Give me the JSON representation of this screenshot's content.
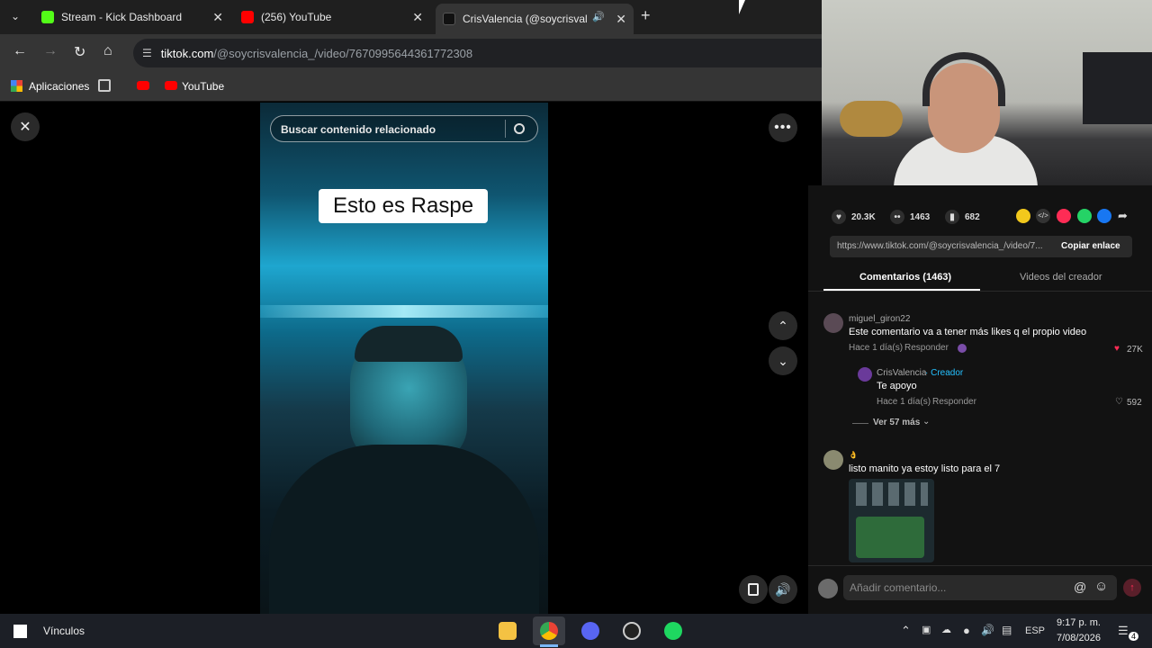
{
  "browser": {
    "tabs": [
      {
        "title": "Stream - Kick Dashboard"
      },
      {
        "title": "(256) YouTube"
      },
      {
        "title": "CrisValencia (@soycrisvalen"
      }
    ],
    "new_tab": "+",
    "url_host": "tiktok.com",
    "url_path": "/@soycrisvalencia_/video/7670995644361772308",
    "bookmarks": [
      {
        "label": "Aplicaciones"
      },
      {
        "label": "YouTube"
      }
    ]
  },
  "video": {
    "search_placeholder": "Buscar contenido relacionado",
    "caption": "Esto es Raspe"
  },
  "stats": {
    "likes": "20.3K",
    "comments": "1463",
    "saves": "682"
  },
  "link": {
    "url": "https://www.tiktok.com/@soycrisvalencia_/video/7...",
    "copy_label": "Copiar enlace"
  },
  "comment_tabs": [
    {
      "label": "Comentarios (1463)"
    },
    {
      "label": "Videos del creador"
    }
  ],
  "comments": [
    {
      "user": "miguel_giron22",
      "text": "Este comentario va a tener más likes q el propio video",
      "time": "Hace 1 día(s)",
      "reply": "Responder",
      "likes": "27K",
      "replies": [
        {
          "user": "CrisValencia",
          "creator_tag": " · Creador",
          "text": "Te apoyo",
          "time": "Hace 1 día(s)",
          "reply": "Responder",
          "likes": "592"
        }
      ],
      "more": "Ver 57 más"
    },
    {
      "user": "👌",
      "text": "listo manito ya estoy listo para el 7"
    }
  ],
  "add_comment": {
    "placeholder": "Añadir comentario..."
  },
  "taskbar": {
    "search_label": "Vínculos",
    "lang": "ESP",
    "time": "9:17 p. m.",
    "date": "7/08/2026",
    "notif_count": "4"
  },
  "colors": {
    "accent_red": "#fe2c55",
    "creator_blue": "#25c1ff",
    "kick_green": "#53fc18",
    "youtube_red": "#ff0000"
  }
}
